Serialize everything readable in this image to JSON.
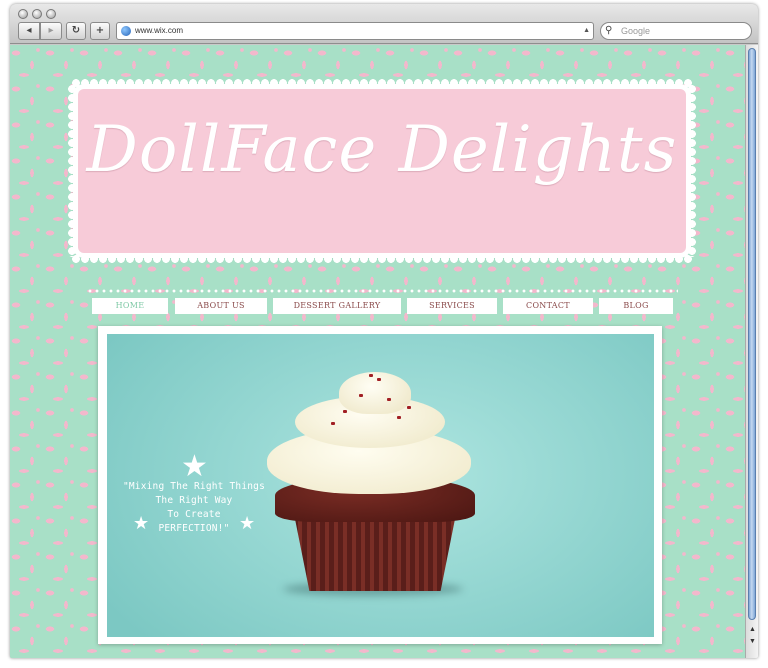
{
  "browser": {
    "url": "www.wix.com",
    "search_placeholder": "Google",
    "back_icon": "back-arrow-icon",
    "forward_icon": "forward-arrow-icon",
    "reload_icon": "reload-icon",
    "add_icon": "plus-icon"
  },
  "site": {
    "title": "DollFace Delights",
    "nav": [
      {
        "label": "HOME",
        "active": true
      },
      {
        "label": "ABOUT US"
      },
      {
        "label": "DESSERT GALLERY"
      },
      {
        "label": "SERVICES"
      },
      {
        "label": "CONTACT"
      },
      {
        "label": "BLOG"
      }
    ],
    "hero": {
      "quote_lines": [
        "\"Mixing The Right Things",
        "The Right Way",
        "To Create",
        "PERFECTION!\""
      ]
    },
    "colors": {
      "background_mint": "#a8e0c7",
      "pattern_pink": "#f3b8cc",
      "header_pink": "#f7cbd8",
      "nav_active": "#7fc9a6",
      "nav_text": "#8a4a4a"
    }
  }
}
